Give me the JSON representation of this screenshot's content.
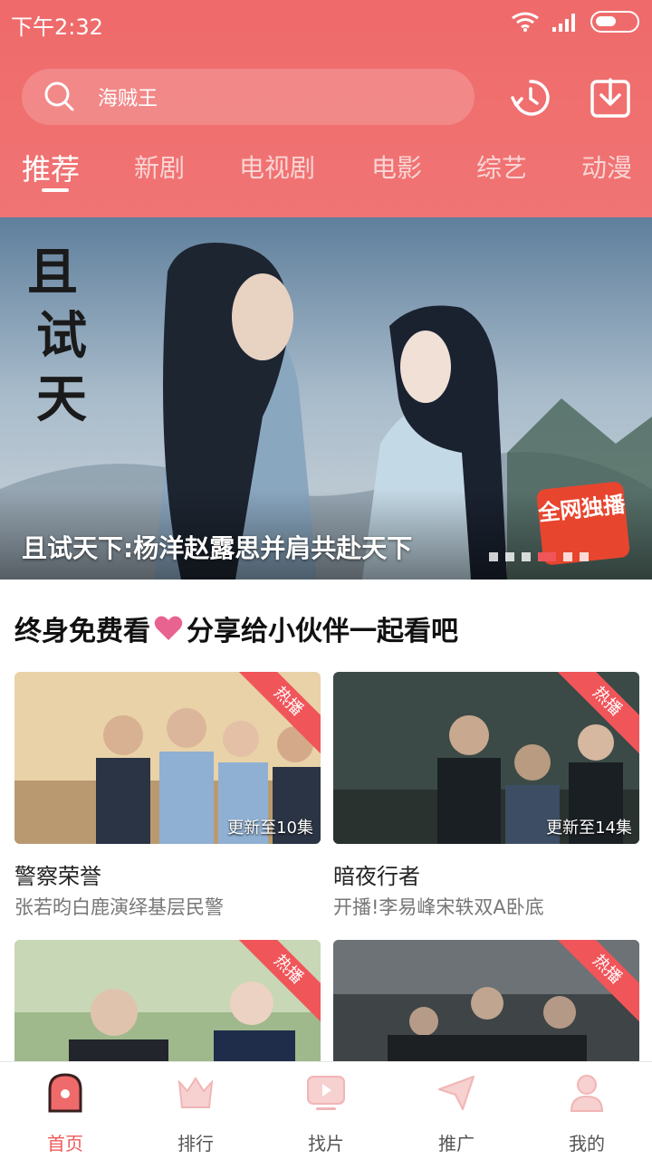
{
  "status": {
    "time": "下午2:32"
  },
  "search": {
    "text": "海贼王"
  },
  "tabs": [
    {
      "label": "推荐",
      "active": true
    },
    {
      "label": "新剧"
    },
    {
      "label": "电视剧"
    },
    {
      "label": "电影"
    },
    {
      "label": "综艺"
    },
    {
      "label": "动漫"
    }
  ],
  "banner": {
    "caption": "且试天下:杨洋赵露思并肩共赴天下",
    "badge": "全网独播",
    "dots_count": 6,
    "active_dot": 4
  },
  "section": {
    "title_left": "终身免费看",
    "title_right": "分享给小伙伴一起看吧"
  },
  "cards": [
    {
      "title": "警察荣誉",
      "subtitle": "张若昀白鹿演绎基层民警",
      "update": "更新至10集",
      "ribbon": "热播"
    },
    {
      "title": "暗夜行者",
      "subtitle": "开播!李易峰宋轶双A卧底",
      "update": "更新至14集",
      "ribbon": "热播"
    },
    {
      "title": "",
      "subtitle": "",
      "update": "",
      "ribbon": "热播"
    },
    {
      "title": "",
      "subtitle": "",
      "update": "",
      "ribbon": "热播"
    }
  ],
  "nav": [
    {
      "label": "首页",
      "icon": "home-icon",
      "active": true
    },
    {
      "label": "排行",
      "icon": "crown-icon"
    },
    {
      "label": "找片",
      "icon": "play-icon"
    },
    {
      "label": "推广",
      "icon": "send-icon"
    },
    {
      "label": "我的",
      "icon": "user-icon"
    }
  ],
  "colors": {
    "accent": "#ef5a5a",
    "header": "#ef6a6a",
    "ribbon": "#f0555a"
  }
}
